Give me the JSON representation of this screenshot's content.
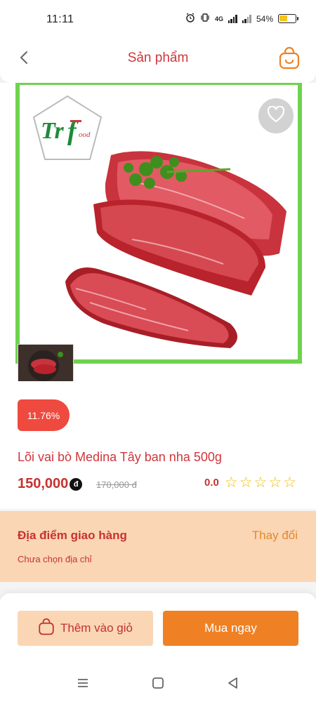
{
  "status_bar": {
    "time": "11:11",
    "network": "4G",
    "battery_percent": 54,
    "battery_label": "54%"
  },
  "header": {
    "title": "Sản phẩm",
    "back_icon": "chevron-left-icon",
    "cart_icon": "shopping-bag-icon"
  },
  "product": {
    "brand_logo_text": "TrFood",
    "discount_label": "11.76%",
    "name": "Lõi vai bò Medina Tây ban nha 500g",
    "price": "150,000",
    "currency_symbol": "đ",
    "old_price": "170,000 đ",
    "rating_value": "0.0",
    "rating_stars": 0,
    "rating_max": 5,
    "wishlist_icon": "heart-icon"
  },
  "delivery": {
    "label": "Địa điểm giao hàng",
    "change_label": "Thay đổi",
    "address": "Chưa chọn địa chỉ"
  },
  "actions": {
    "add_to_cart": "Thêm vào giỏ",
    "buy_now": "Mua ngay"
  },
  "colors": {
    "brand_red": "#d0363b",
    "accent_orange": "#ef8124",
    "peach": "#fbd6b5",
    "frame_green": "#6fd34e",
    "star": "#f0b90b"
  }
}
